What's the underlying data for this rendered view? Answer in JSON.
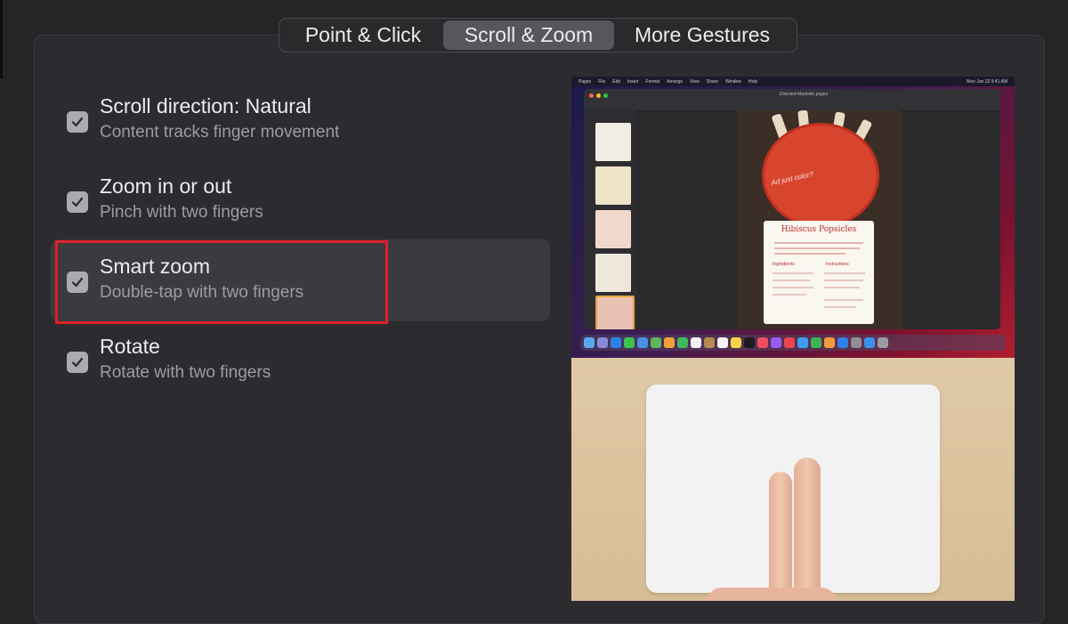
{
  "tabs": {
    "point_click": "Point & Click",
    "scroll_zoom": "Scroll & Zoom",
    "more_gestures": "More Gestures"
  },
  "selected_tab": "Scroll & Zoom",
  "options": [
    {
      "title": "Scroll direction: Natural",
      "subtitle": "Content tracks finger movement",
      "checked": true
    },
    {
      "title": "Zoom in or out",
      "subtitle": "Pinch with two fingers",
      "checked": true
    },
    {
      "title": "Smart zoom",
      "subtitle": "Double-tap with two fingers",
      "checked": true,
      "selected": true,
      "highlighted": true
    },
    {
      "title": "Rotate",
      "subtitle": "Rotate with two fingers",
      "checked": true
    }
  ],
  "preview": {
    "menu_items": [
      "Pages",
      "File",
      "Edit",
      "Insert",
      "Format",
      "Arrange",
      "View",
      "Share",
      "Window",
      "Help"
    ],
    "clock": "Mon Jun 22 9:41 AM",
    "window_title": "Directed Marketin pages",
    "doc_title": "Hibiscus Popsicles",
    "handwritten_note": "Ad just color?",
    "card_sections": [
      "Ingredients",
      "Instructions"
    ]
  },
  "colors": {
    "background": "#252528",
    "highlight_box": "#e0202a",
    "selected_tab_bg": "#56565b",
    "checkbox": "#ababaf"
  },
  "icons": {
    "checkbox": "checkmark-icon"
  }
}
